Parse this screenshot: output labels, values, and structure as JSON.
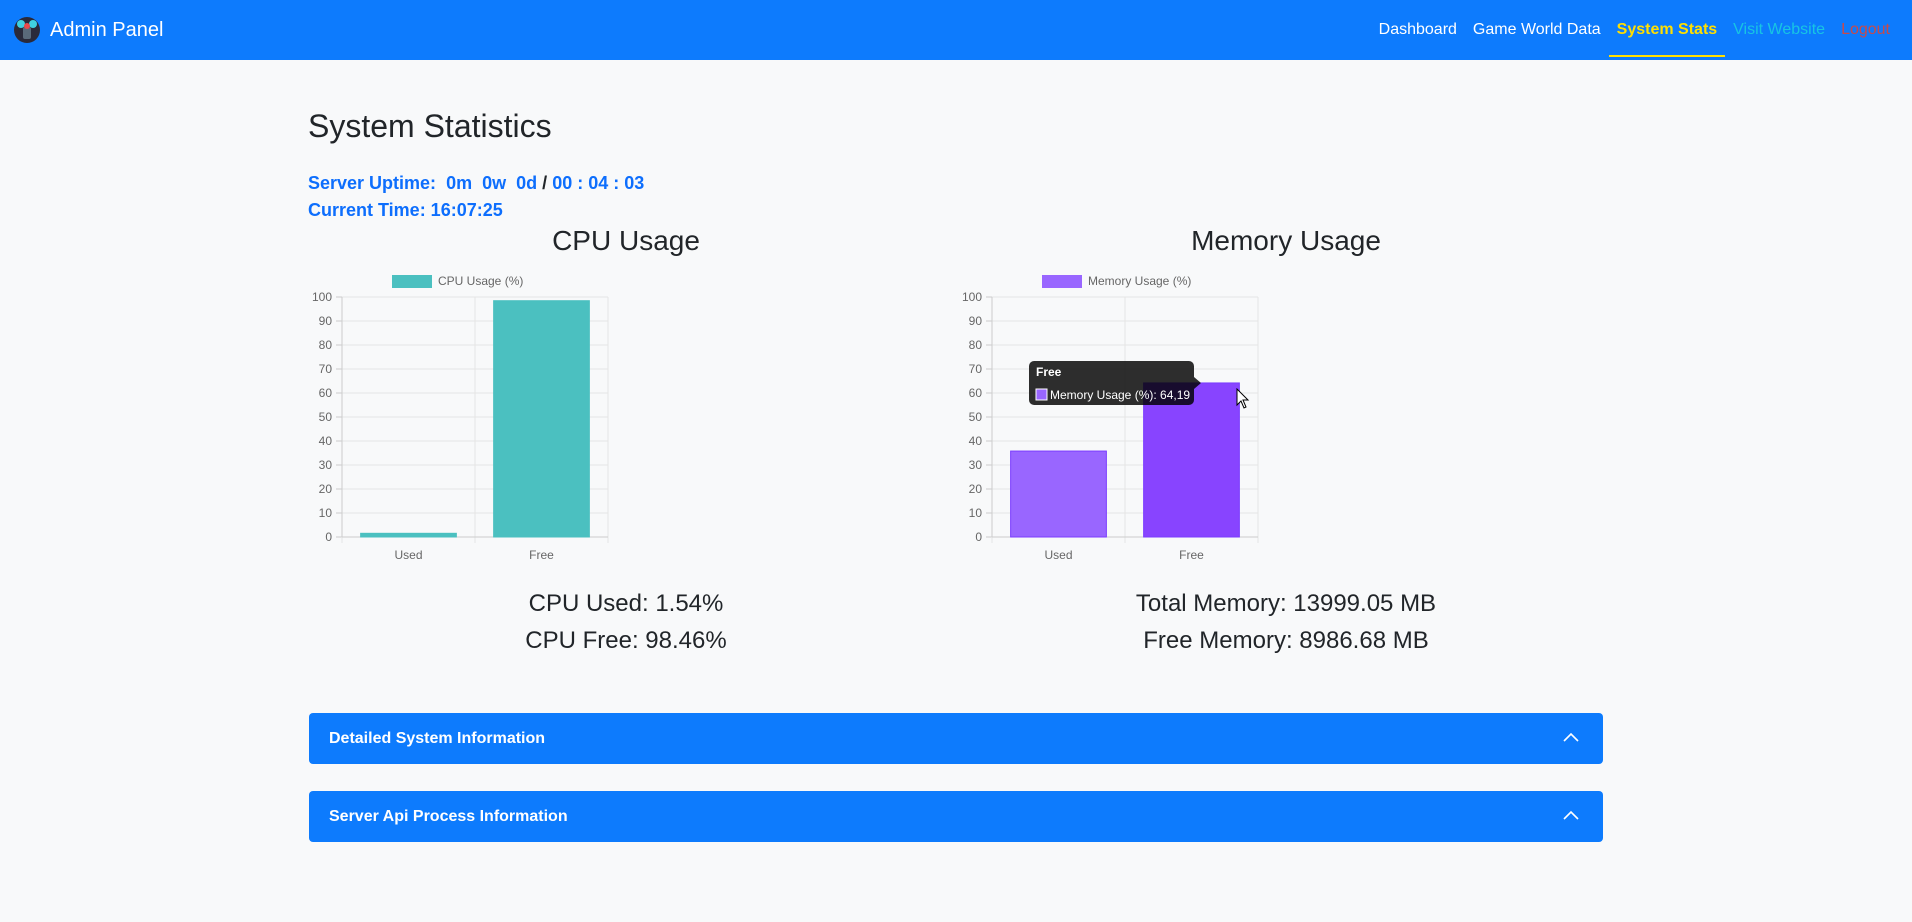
{
  "navbar": {
    "brand": "Admin Panel",
    "brand_icon": "joystick-logo-icon",
    "items": [
      {
        "label": "Dashboard",
        "active": false
      },
      {
        "label": "Game World Data",
        "active": false
      },
      {
        "label": "System Stats",
        "active": true
      },
      {
        "label": "Visit Website",
        "active": false
      },
      {
        "label": "Logout",
        "active": false
      }
    ],
    "colors": {
      "background": "#0d7bfd",
      "active": "#ffdf00",
      "visit": "#17c5e3",
      "logout": "#c94a4a"
    }
  },
  "page": {
    "title": "System Statistics",
    "uptime_label": "Server Uptime:",
    "uptime_months": "0m",
    "uptime_weeks": "0w",
    "uptime_days": "0d",
    "uptime_separator": "/",
    "uptime_hours": "00",
    "uptime_minutes": "04",
    "uptime_seconds": "03",
    "current_time": "Current Time: 16:07:25"
  },
  "cpu": {
    "title": "CPU Usage",
    "used_text": "CPU Used: 1.54%",
    "free_text": "CPU Free: 98.46%"
  },
  "memory": {
    "title": "Memory Usage",
    "total_text": "Total Memory: 13999.05 MB",
    "free_text": "Free Memory: 8986.68 MB",
    "tooltip_title": "Free",
    "tooltip_label": "Memory Usage (%): 64,19"
  },
  "chart_data": [
    {
      "type": "bar",
      "id": "cpu",
      "categories": [
        "Used",
        "Free"
      ],
      "series": [
        {
          "name": "CPU Usage (%)",
          "values": [
            1.54,
            98.46
          ],
          "color": "#4bc0c0"
        }
      ],
      "ylim": [
        0,
        100
      ],
      "yticks": [
        0,
        10,
        20,
        30,
        40,
        50,
        60,
        70,
        80,
        90,
        100
      ],
      "grid": true,
      "legend": "top"
    },
    {
      "type": "bar",
      "id": "memory",
      "categories": [
        "Used",
        "Free"
      ],
      "series": [
        {
          "name": "Memory Usage (%)",
          "values": [
            35.81,
            64.19
          ],
          "colors": [
            "#9966ff",
            "#8844ff"
          ]
        }
      ],
      "ylim": [
        0,
        100
      ],
      "yticks": [
        0,
        10,
        20,
        30,
        40,
        50,
        60,
        70,
        80,
        90,
        100
      ],
      "grid": true,
      "legend": "top"
    }
  ],
  "accordion": [
    {
      "label": "Detailed System Information",
      "icon": "chevron-up-icon"
    },
    {
      "label": "Server Api Process Information",
      "icon": "chevron-up-icon"
    }
  ]
}
